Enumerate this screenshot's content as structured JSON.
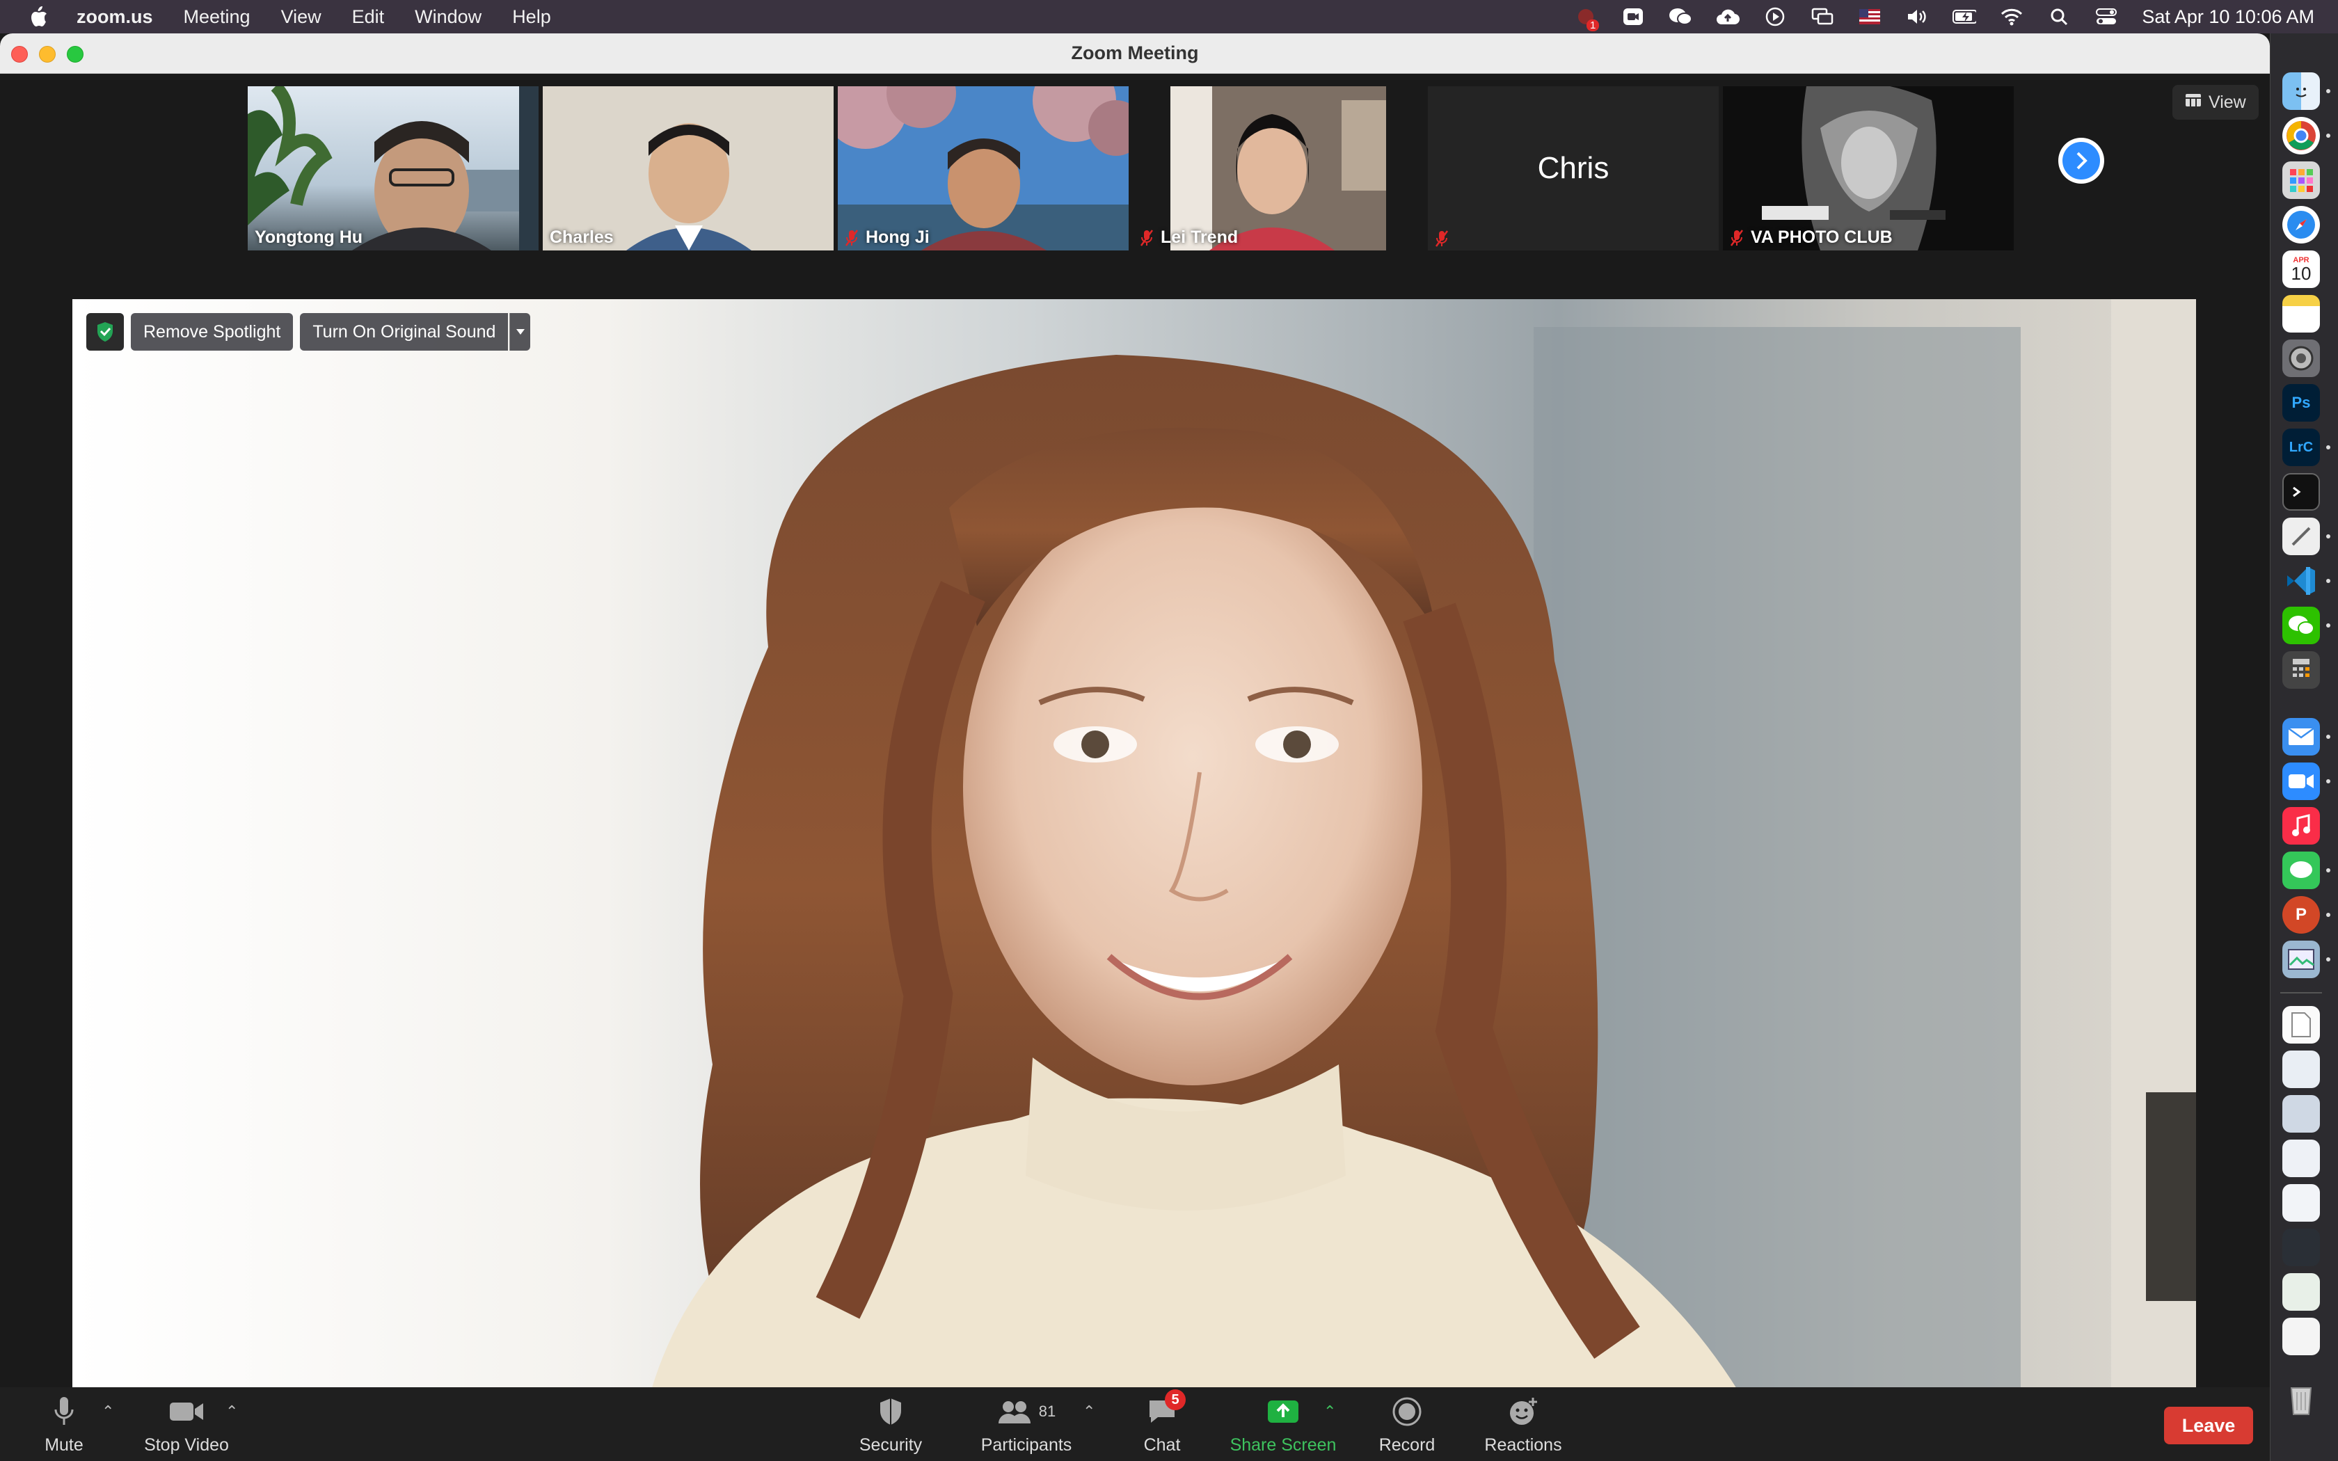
{
  "menubar": {
    "app_name": "zoom.us",
    "menus": [
      "Meeting",
      "View",
      "Edit",
      "Window",
      "Help"
    ],
    "notification_count": "1",
    "clock": "Sat Apr 10  10:06 AM"
  },
  "window": {
    "title": "Zoom Meeting"
  },
  "view_button": {
    "label": "View"
  },
  "participants_strip": [
    {
      "name": "Yongtong Hu",
      "muted": false,
      "video": true
    },
    {
      "name": "Charles",
      "muted": false,
      "video": true
    },
    {
      "name": "Hong Ji",
      "muted": true,
      "video": true
    },
    {
      "name": "Lei Trend",
      "muted": true,
      "video": true
    },
    {
      "name": "Chris",
      "muted": true,
      "video": false
    },
    {
      "name": "VA PHOTO CLUB",
      "muted": true,
      "video": true
    }
  ],
  "spotlight_controls": {
    "remove_spotlight": "Remove Spotlight",
    "original_sound": "Turn On Original Sound"
  },
  "toolbar": {
    "mute": "Mute",
    "stop_video": "Stop Video",
    "security": "Security",
    "participants": "Participants",
    "participants_count": "81",
    "chat": "Chat",
    "chat_badge": "5",
    "share_screen": "Share Screen",
    "record": "Record",
    "reactions": "Reactions",
    "leave": "Leave"
  },
  "dock": {
    "calendar_month": "APR",
    "calendar_day": "10",
    "ps_label": "Ps",
    "lrc_label": "LrC"
  },
  "colors": {
    "menubar_bg": "#3a3340",
    "accent_blue": "#2d8cff",
    "share_green": "#1fb141",
    "leave_red": "#d83b32",
    "badge_red": "#e02828"
  }
}
